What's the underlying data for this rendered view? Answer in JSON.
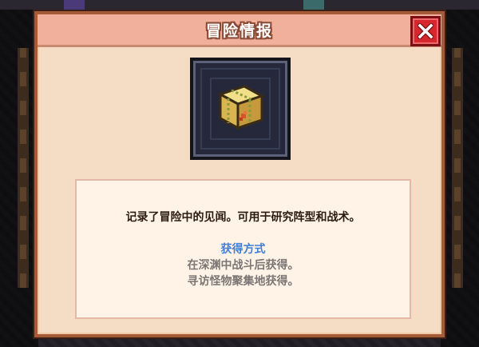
{
  "dialog": {
    "title": "冒险情报",
    "description": "记录了冒险中的见闻。可用于研究阵型和战术。",
    "obtain": {
      "heading": "获得方式",
      "methods": [
        "在深渊中战斗后获得。",
        "寻访怪物聚集地获得。"
      ]
    },
    "item_icon": "parcel-icon",
    "close_icon": "close-icon"
  },
  "colors": {
    "panel_bg": "#f5dcc4",
    "title_bar": "#f0b09c",
    "border": "#a55a38",
    "close_red": "#d6262e",
    "obtain_heading": "#3f7fd6",
    "obtain_text": "#7b7674",
    "item_frame": "#24283a"
  }
}
